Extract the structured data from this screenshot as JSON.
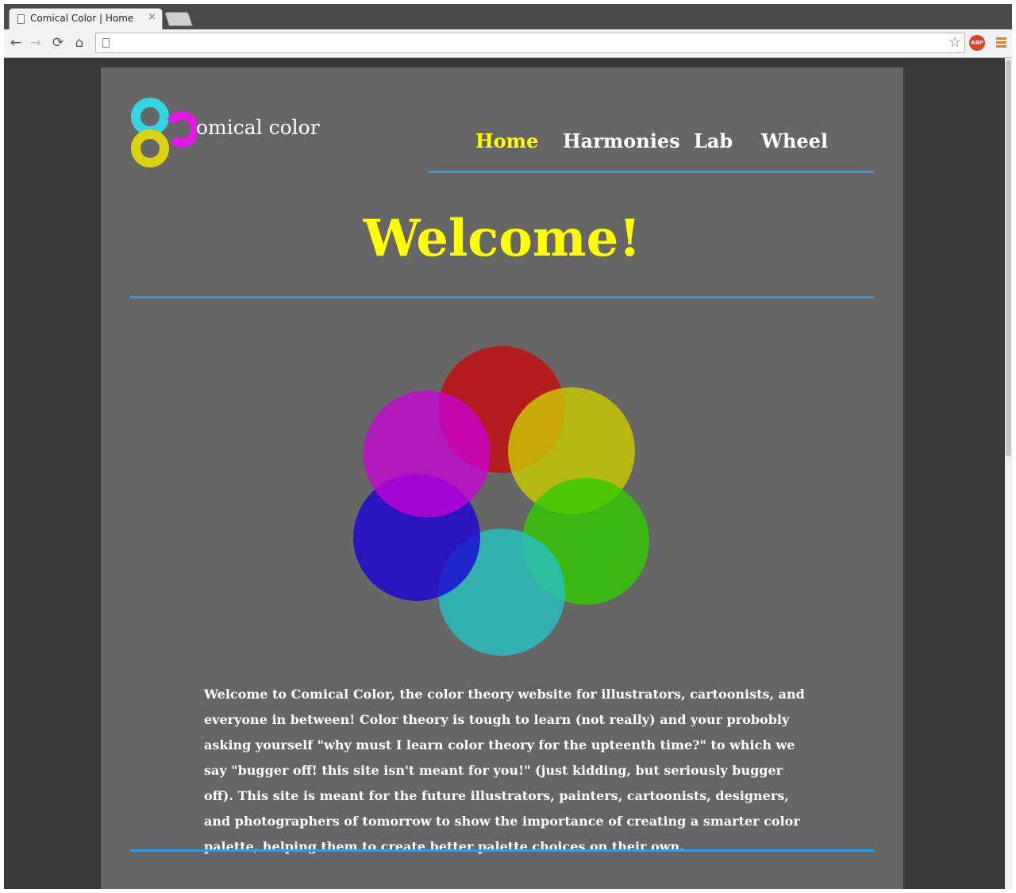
{
  "browser": {
    "tab_title": "Comical Color | Home",
    "tab_close": "×",
    "address_value": "",
    "back_glyph": "←",
    "forward_glyph": "→",
    "reload_glyph": "⟳",
    "home_glyph": "⌂",
    "star_glyph": "☆",
    "abp_label": "ABP"
  },
  "site": {
    "logo_text": "omical color",
    "logo_colors": [
      "#33d6e0",
      "#e617e6",
      "#d9d40f"
    ],
    "nav": [
      {
        "label": "Home",
        "active": true
      },
      {
        "label": "Harmonies",
        "active": false
      },
      {
        "label": "Lab",
        "active": false
      },
      {
        "label": "Wheel",
        "active": false
      }
    ],
    "heading": "Welcome!",
    "intro": "Welcome to Comical Color, the color theory website for illustrators, cartoonists, and everyone in between! Color theory is tough to learn (not really) and your probobly asking yourself \"why must I learn color theory for the upteenth time?\" to which we say \"bugger off! this site isn't meant for you!\" (just kidding, but seriously bugger off). This site is meant for the future illustrators, painters, cartoonists, designers, and photographers of tomorrow to show the importance of creating a smarter color palette, helping them to create better palette choices on their own.",
    "wheel_colors": {
      "red": "#c40d0d",
      "yellow": "#cccc00",
      "green": "#33cc00",
      "cyan": "#26c2c2",
      "blue": "#1a00d9",
      "magenta": "#cc00d9"
    },
    "accent_color": "#3399e0",
    "highlight_color": "#ffff00"
  }
}
